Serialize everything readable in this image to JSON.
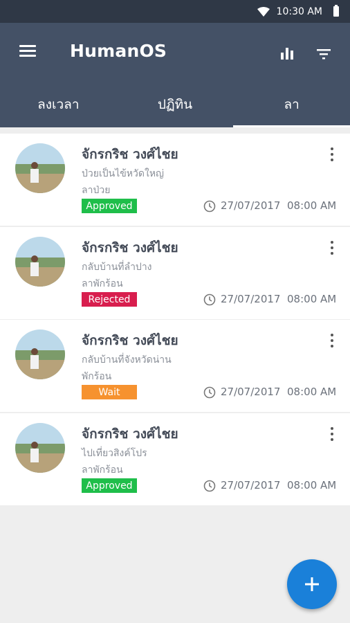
{
  "status_bar": {
    "time": "10:30 AM",
    "wifi_icon": "wifi-icon",
    "battery_icon": "battery-icon"
  },
  "app_bar": {
    "title": "HumanOS",
    "menu_icon": "menu-icon",
    "stats_icon": "bar-chart-icon",
    "filter_icon": "filter-icon",
    "background": "#445166"
  },
  "tabs": [
    {
      "label": "ลงเวลา",
      "active": false
    },
    {
      "label": "ปฏิทิน",
      "active": false
    },
    {
      "label": "ลา",
      "active": true
    }
  ],
  "requests": [
    {
      "name": "จักรกริช วงศ์ไชย",
      "reason": "ป่วยเป็นไข้หวัดใหญ่",
      "type": "ลาป่วย",
      "status": "Approved",
      "status_color": "#1fbe4a",
      "date": "27/07/2017",
      "time": "08:00 AM"
    },
    {
      "name": "จักรกริช วงศ์ไชย",
      "reason": "กลับบ้านที่ลำปาง",
      "type": "ลาพักร้อน",
      "status": "Rejected",
      "status_color": "#d81e4e",
      "date": "27/07/2017",
      "time": "08:00 AM"
    },
    {
      "name": "จักรกริช วงศ์ไชย",
      "reason": "กลับบ้านที่จังหวัดน่าน",
      "type": "พักร้อน",
      "status": "Wait",
      "status_color": "#f6922f",
      "date": "27/07/2017",
      "time": "08:00 AM"
    },
    {
      "name": "จักรกริช วงศ์ไชย",
      "reason": "ไปเที่ยวสิงค์โปร",
      "type": "ลาพักร้อน",
      "status": "Approved",
      "status_color": "#1fbe4a",
      "date": "27/07/2017",
      "time": "08:00 AM"
    }
  ],
  "fab": {
    "icon": "plus-icon",
    "label": "+",
    "color": "#1a80d9"
  }
}
